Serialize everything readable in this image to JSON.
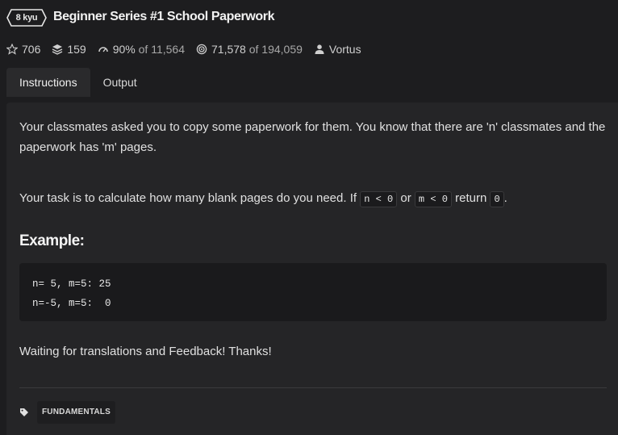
{
  "kata": {
    "rank": "8 kyu",
    "title": "Beginner Series #1 School Paperwork"
  },
  "stats": {
    "stars": "706",
    "collections": "159",
    "satisfaction": "90%",
    "satisfaction_of": "of 11,564",
    "completed": "71,578",
    "completed_of": "of 194,059",
    "author": "Vortus"
  },
  "tabs": [
    {
      "label": "Instructions",
      "active": true
    },
    {
      "label": "Output",
      "active": false
    }
  ],
  "instructions": {
    "paragraph1": "Your classmates asked you to copy some paperwork for them. You know that there are 'n' classmates and the paperwork has 'm' pages.",
    "paragraph2_prefix": "Your task is to calculate how many blank pages do you need. If",
    "code_n": "n < 0",
    "or_text": "or",
    "code_m": "m < 0",
    "return_text": "return",
    "code_zero": "0",
    "period": ".",
    "example_heading": "Example:",
    "code_line1": "n= 5, m=5: 25",
    "code_line2": "n=-5, m=5:  0",
    "paragraph3": "Waiting for translations and Feedback! Thanks!"
  },
  "tags": [
    "FUNDAMENTALS"
  ],
  "icons": {
    "star": "star-icon",
    "collection": "stack-icon",
    "satisfaction": "gauge-icon",
    "completed": "target-icon",
    "author": "user-icon",
    "tag": "tag-icon"
  },
  "colors": {
    "background": "#1d1d1f",
    "panel": "#252527",
    "code_bg": "#1a1a1c"
  }
}
